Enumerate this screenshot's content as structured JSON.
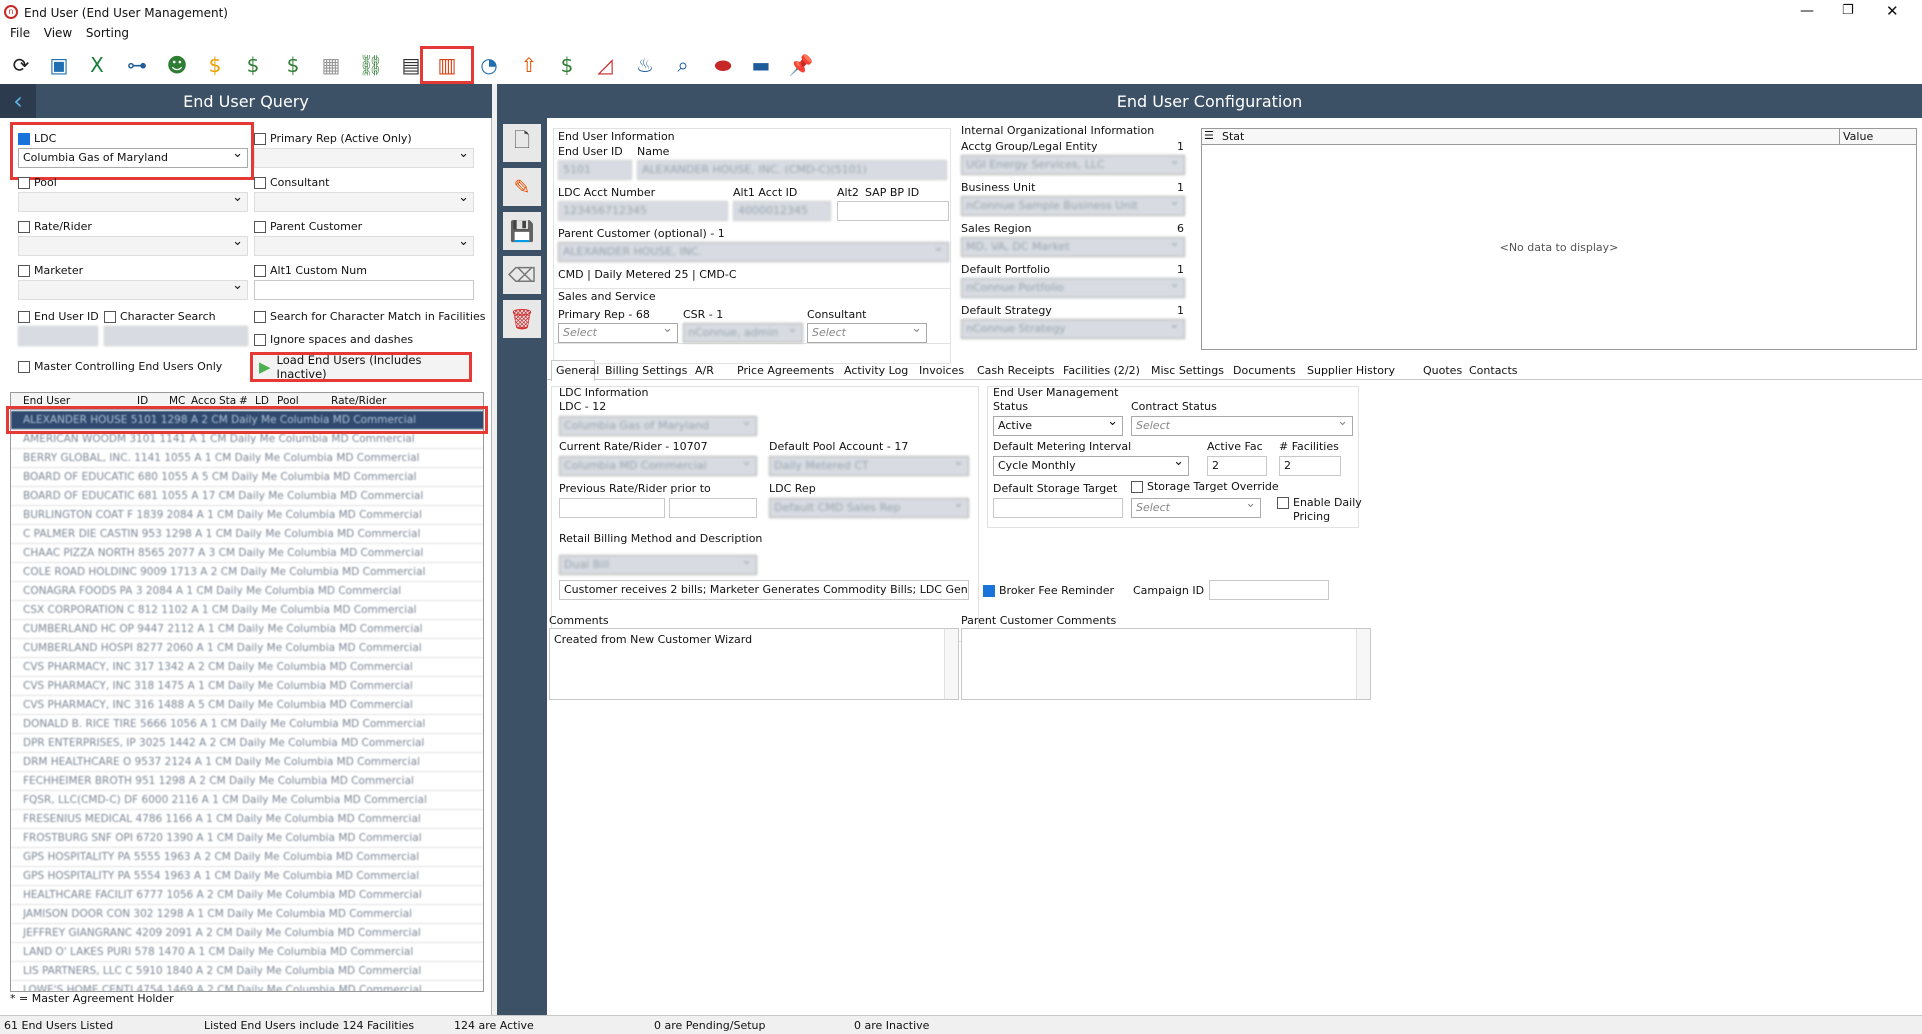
{
  "window": {
    "title": "End User (End User Management)",
    "app_icon": "app-logo-icon"
  },
  "menu": [
    "File",
    "View",
    "Sorting"
  ],
  "toolbar": {
    "icons": [
      "refresh-icon",
      "panel-icon",
      "excel-icon",
      "hierarchy-icon",
      "users-group-icon",
      "dollar-doc-icon",
      "money-stack-icon",
      "dollar-doc2-icon",
      "calendar-icon",
      "link-icon",
      "id-card-icon",
      "building-icon",
      "flame-drop-icon",
      "upload-arrow-icon",
      "hand-money-icon",
      "chart-card-icon",
      "flame-building-icon",
      "zoom-icon",
      "toggle-icon",
      "card-icon",
      "pin-icon"
    ]
  },
  "left": {
    "header": "End User Query",
    "ldc_label": "LDC",
    "ldc_value": "Columbia Gas of Maryland",
    "primary_rep_label": "Primary Rep (Active Only)",
    "pool_label": "Pool",
    "consultant_label": "Consultant",
    "rate_label": "Rate/Rider",
    "parent_label": "Parent Customer",
    "marketer_label": "Marketer",
    "alt1_label": "Alt1 Custom Num",
    "enduserid_label": "End User ID",
    "charsearch_label": "Character Search",
    "search_facilities_label": "Search for Character Match in Facilities",
    "ignore_spaces_label": "Ignore spaces and dashes",
    "master_label": "Master Controlling End Users Only",
    "load_button": "Load End Users (Includes Inactive)",
    "grid_headers": [
      "End User",
      "ID",
      "MC",
      "Acco",
      "Sta",
      "#",
      "LD",
      "Pool",
      "Rate/Rider"
    ],
    "rows": [
      "ALEXANDER HOUSE  5101  1298  A  2  CM  Daily Me  Columbia MD Commercial",
      "AMERICAN WOODM  3101  1141  A  1  CM  Daily Me  Columbia MD Commercial",
      "BERRY GLOBAL, INC.  1141  1055  A  1  CM  Daily Me  Columbia MD Commercial",
      "BOARD OF EDUCATIC  680  1055  A  5  CM  Daily Me  Columbia MD Commercial",
      "BOARD OF EDUCATIC  681  1055  A  17  CM  Daily Me  Columbia MD Commercial",
      "BURLINGTON COAT F  1839  2084  A  1  CM  Daily Me  Columbia MD Commercial",
      "C PALMER DIE CASTIN  953  1298  A  1  CM  Daily Me  Columbia MD Commercial",
      "CHAAC PIZZA NORTH  8565  2077  A  3  CM  Daily Me  Columbia MD Commercial",
      "COLE ROAD HOLDINC  9009  1713  A  2  CM  Daily Me  Columbia MD Commercial",
      "CONAGRA FOODS PA  3  2084  A  1  CM  Daily Me  Columbia MD Commercial",
      "CSX CORPORATION C  812  1102  A  1  CM  Daily Me  Columbia MD Commercial",
      "CUMBERLAND HC OP  9447  2112  A  1  CM  Daily Me  Columbia MD Commercial",
      "CUMBERLAND HOSPI  8277  2060  A  1  CM  Daily Me  Columbia MD Commercial",
      "CVS PHARMACY, INC  317  1342  A  2  CM  Daily Me  Columbia MD Commercial",
      "CVS PHARMACY, INC  318  1475  A  1  CM  Daily Me  Columbia MD Commercial",
      "CVS PHARMACY, INC  316  1488  A  5  CM  Daily Me  Columbia MD Commercial",
      "DONALD B. RICE TIRE  5666  1056  A  1  CM  Daily Me  Columbia MD Commercial",
      "DPR ENTERPRISES, IP  3025  1442  A  2  CM  Daily Me  Columbia MD Commercial",
      "DRM HEALTHCARE O  9537  2124  A  1  CM  Daily Me  Columbia MD Commercial",
      "FECHHEIMER BROTH  951  1298  A  2  CM  Daily Me  Columbia MD Commercial",
      "FQSR, LLC(CMD-C) DF  6000  2116  A  1  CM  Daily Me  Columbia MD Commercial",
      "FRESENIUS MEDICAL  4786  1166  A  1  CM  Daily Me  Columbia MD Commercial",
      "FROSTBURG SNF OPI  6720  1390  A  1  CM  Daily Me  Columbia MD Commercial",
      "GPS HOSPITALITY PA  5555  1963  A  2  CM  Daily Me  Columbia MD Commercial",
      "GPS HOSPITALITY PA  5554  1963  A  1  CM  Daily Me  Columbia MD Commercial",
      "HEALTHCARE FACILIT  6777  1056  A  2  CM  Daily Me  Columbia MD Commercial",
      "JAMISON DOOR CON  302  1298  A  1  CM  Daily Me  Columbia MD Commercial",
      "JEFFREY GIANGRANC  4209  2091  A  2  CM  Daily Me  Columbia MD Commercial",
      "LAND O' LAKES PURI  578  1470  A  1  CM  Daily Me  Columbia MD Commercial",
      "LIS PARTNERS, LLC C  5910  1840  A  2  CM  Daily Me  Columbia MD Commercial",
      "LOWE'S HOME CENTI  4754  1469  A  2  CM  Daily Me  Columbia MD Commercial"
    ],
    "footer_note": "* = Master Agreement Holder"
  },
  "right": {
    "header": "End User Configuration",
    "enduserinfo": "End User Information",
    "enduserid_label": "End User ID",
    "name_label": "Name",
    "id_value": "5101",
    "name_value": "ALEXANDER HOUSE, INC. (CMD-C)(5101)",
    "acct_label": "LDC Acct Number",
    "acct_value": "123456712345",
    "alt1_label": "Alt1 Acct ID",
    "alt1_value": "4000012345",
    "alt2_label": "Alt2",
    "sap_label": "SAP BP ID",
    "parent_label": "Parent Customer (optional) - 1",
    "parent_value": "ALEXANDER HOUSE, INC.",
    "cmd_line": "CMD  |  Daily Metered 25  |  CMD-C",
    "sales_service": "Sales and Service",
    "primary_rep": "Primary Rep - 68",
    "csr": "CSR - 1",
    "consultant": "Consultant",
    "select_ph": "Select",
    "csr_value": "nConnue, admin",
    "internal_info": "Internal Organizational Information",
    "acctg": "Acctg Group/Legal Entity",
    "acctg_count": "1",
    "acctg_value": "UGI Energy Services, LLC",
    "bu": "Business Unit",
    "bu_count": "1",
    "bu_value": "nConnue Sample Business Unit",
    "sales_region": "Sales Region",
    "sr_count": "6",
    "sr_value": "MD, VA, DC Market",
    "portfolio": "Default Portfolio",
    "pf_count": "1",
    "pf_value": "nConnue Portfolio",
    "strategy": "Default Strategy",
    "st_count": "1",
    "st_value": "nConnue Strategy",
    "stat_col": "Stat",
    "value_col": "Value",
    "no_data": "<No data to display>",
    "tabs": [
      "General",
      "Billing Settings",
      "A/R",
      "Price Agreements",
      "Activity Log",
      "Invoices",
      "Cash Receipts",
      "Facilities (2/2)",
      "Misc Settings",
      "Documents",
      "Supplier History",
      "Quotes",
      "Contacts"
    ],
    "ldc_info": "LDC Information",
    "ldc_count": "LDC - 12",
    "ldc_value": "Columbia Gas of Maryland",
    "current_rate": "Current Rate/Rider - 10707",
    "rate_value": "Columbia MD Commercial",
    "default_pool": "Default Pool Account - 17",
    "pool_value": "Daily Metered CT",
    "prev_rate": "Previous Rate/Rider prior to",
    "ldc_rep": "LDC Rep",
    "ldc_rep_value": "Default CMD Sales Rep",
    "retail_billing": "Retail Billing Method and Description",
    "billing_value": "Dual Bill",
    "billing_desc": "Customer receives 2 bills; Marketer Generates Commodity Bills; LDC Genera",
    "eum": "End User Management",
    "status_label": "Status",
    "status_value": "Active",
    "contract_status": "Contract Status",
    "metering": "Default Metering Interval",
    "metering_value": "Cycle Monthly",
    "active_fac": "Active Fac",
    "active_fac_value": "2",
    "num_fac": "# Facilities",
    "num_fac_value": "2",
    "storage_target": "Default Storage Target",
    "storage_override": "Storage Target Override",
    "enable_daily": "Enable Daily",
    "pricing": "Pricing",
    "broker_fee": "Broker Fee Reminder",
    "campaign": "Campaign ID",
    "comments": "Comments",
    "comments_value": "Created from New Customer Wizard",
    "parent_comments": "Parent Customer Comments"
  },
  "status": {
    "listed": "61 End Users Listed",
    "facilities": "Listed End Users include 124  Facilities",
    "active": "124 are Active",
    "pending": "0 are Pending/Setup",
    "inactive": "0 are Inactive"
  }
}
